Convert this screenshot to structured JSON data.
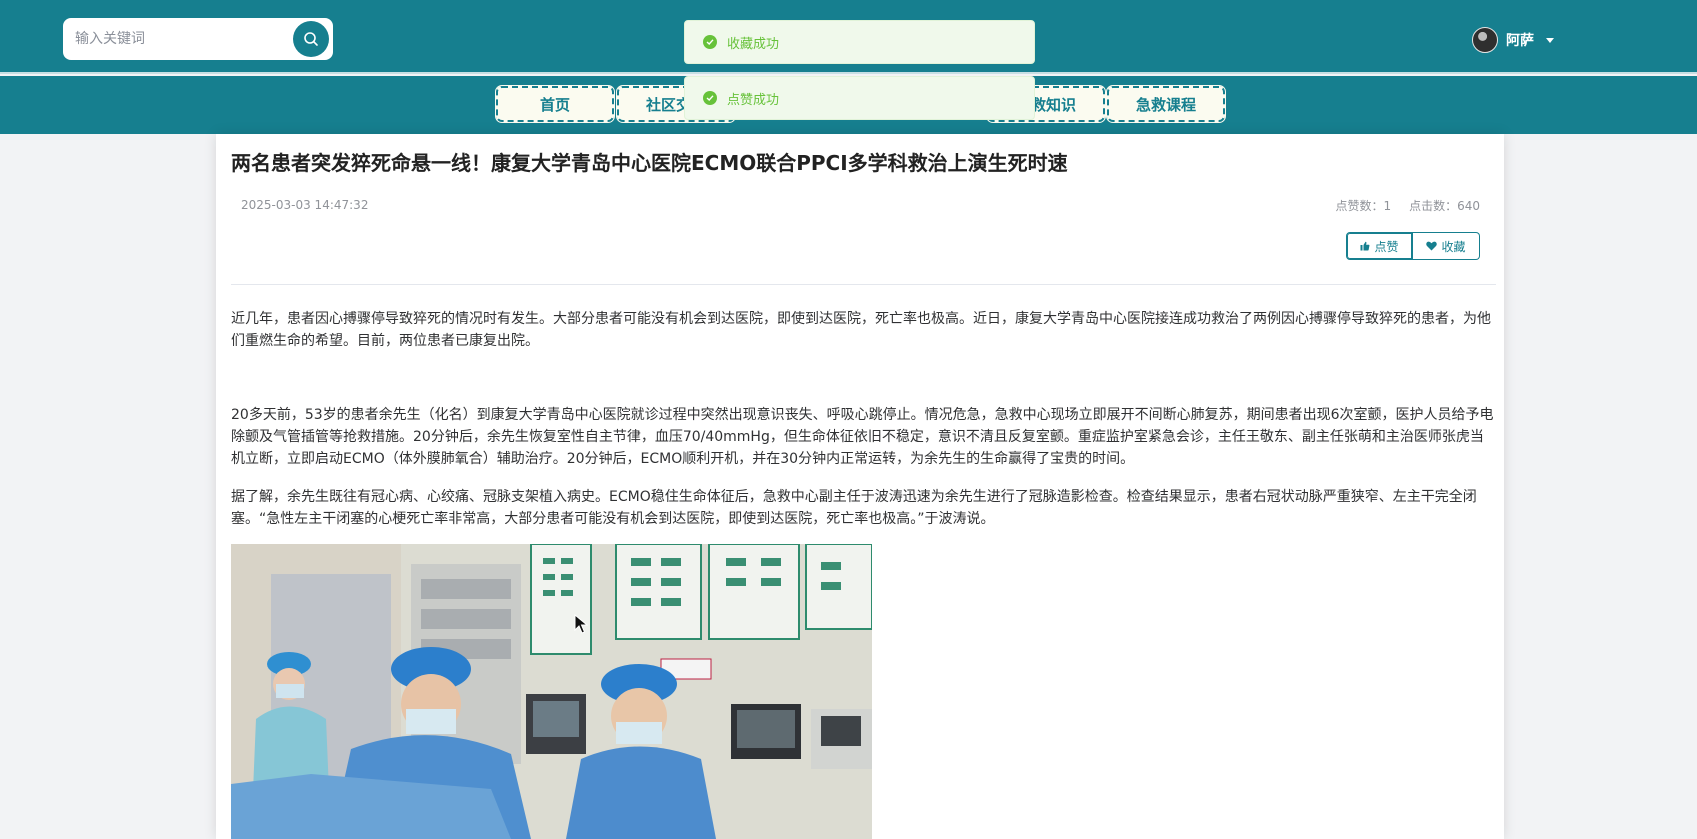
{
  "header": {
    "search_placeholder": "输入关键词",
    "username": "阿萨"
  },
  "nav": {
    "items": [
      "首页",
      "社区交流",
      "急救知识",
      "急救课程"
    ]
  },
  "toasts": [
    {
      "text": "收藏成功"
    },
    {
      "text": "点赞成功"
    }
  ],
  "article": {
    "title": "两名患者突发猝死命悬一线！康复大学青岛中心医院ECMO联合PPCI多学科救治上演生死时速",
    "date": "2025-03-03 14:47:32",
    "likes_label": "点赞数：1",
    "clicks_label": "点击数：640",
    "like_button": "点赞",
    "fav_button": "收藏",
    "paragraphs": [
      "近几年，患者因心搏骤停导致猝死的情况时有发生。大部分患者可能没有机会到达医院，即使到达医院，死亡率也极高。近日，康复大学青岛中心医院接连成功救治了两例因心搏骤停导致猝死的患者，为他们重燃生命的希望。目前，两位患者已康复出院。",
      "20多天前，53岁的患者余先生（化名）到康复大学青岛中心医院就诊过程中突然出现意识丧失、呼吸心跳停止。情况危急，急救中心现场立即展开不间断心肺复苏，期间患者出现6次室颤，医护人员给予电除颤及气管插管等抢救措施。20分钟后，余先生恢复室性自主节律，血压70/40mmHg，但生命体征依旧不稳定，意识不清且反复室颤。重症监护室紧急会诊，主任王敬东、副主任张萌和主治医师张虎当机立断，立即启动ECMO（体外膜肺氧合）辅助治疗。20分钟后，ECMO顺利开机，并在30分钟内正常运转，为余先生的生命赢得了宝贵的时间。",
      "据了解，余先生既往有冠心病、心绞痛、冠脉支架植入病史。ECMO稳住生命体征后，急救中心副主任于波涛迅速为余先生进行了冠脉造影检查。检查结果显示，患者右冠状动脉严重狭窄、左主干完全闭塞。“急性左主干闭塞的心梗死亡率非常高，大部分患者可能没有机会到达医院，即使到达医院，死亡率也极高。”于波涛说。"
    ]
  },
  "colors": {
    "primary": "#167f8f",
    "success": "#67c23a",
    "toast_bg": "#f0f9eb"
  }
}
